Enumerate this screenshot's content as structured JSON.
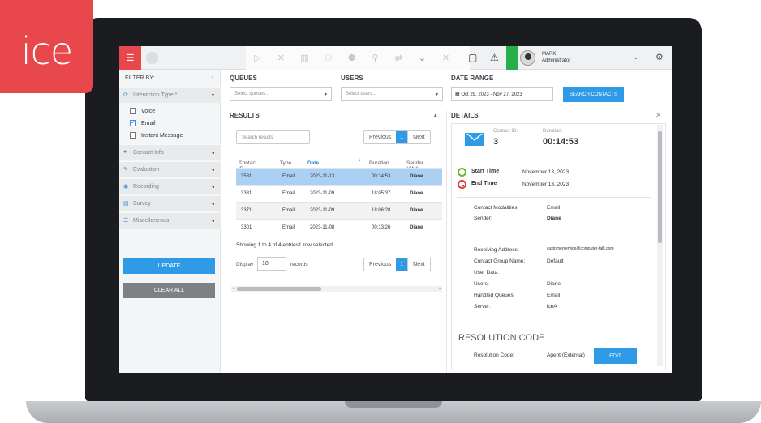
{
  "logo": {
    "text": "ice",
    "color": "#e8474b"
  },
  "topbar": {
    "menu_icon": "☰",
    "toolbar_icons": [
      "play-icon",
      "close-icon",
      "columns-icon",
      "users-icon",
      "team-icon",
      "tree-icon",
      "transfer-icon",
      "chevron-down-icon",
      "close-icon"
    ],
    "toolbar_glyphs": [
      "▷",
      "✕",
      "▥",
      "⚇",
      "⚉",
      "⚲",
      "⇄",
      "⌄",
      "✕"
    ],
    "chat_glyph": "▢",
    "warning_glyph": "⚠",
    "status_color": "#27b04a",
    "user": {
      "name": "MARK",
      "role": "Administrator"
    },
    "chevron": "⌄",
    "gear": "⚙"
  },
  "filter": {
    "heading": "FILTER BY:",
    "collapse": "‹",
    "interaction_type_label": "Interaction Type *",
    "options": [
      {
        "label": "Voice",
        "checked": false
      },
      {
        "label": "Email",
        "checked": true
      },
      {
        "label": "Instant Message",
        "checked": false
      }
    ],
    "sections": [
      "Contact Info",
      "Evaluation",
      "Recording",
      "Survey",
      "Miscellaneous"
    ],
    "section_glyphs": [
      "👤",
      "✎",
      "●",
      "⚑",
      "☰"
    ],
    "update_label": "UPDATE",
    "clear_label": "CLEAR ALL"
  },
  "queues": {
    "label": "QUEUES",
    "placeholder": "Select queues..."
  },
  "users": {
    "label": "USERS",
    "placeholder": "Select users..."
  },
  "date_range": {
    "label": "DATE RANGE",
    "value": "Oct 29, 2023 - Nov 27, 2023"
  },
  "search_button": "SEARCH CONTACTS",
  "results": {
    "label": "RESULTS",
    "search_placeholder": "Search results",
    "prev": "Previous",
    "page": "1",
    "next": "Next",
    "columns": [
      "Contact ID",
      "Type",
      "Date",
      "Duration",
      "Sender (ANI)"
    ],
    "rows": [
      {
        "id": "3581",
        "type": "Email",
        "date": "2023-11-13",
        "duration": "00:14:53",
        "sender": "Diane"
      },
      {
        "id": "3381",
        "type": "Email",
        "date": "2023-11-09",
        "duration": "18:05:37",
        "sender": "Diane"
      },
      {
        "id": "3371",
        "type": "Email",
        "date": "2023-11-09",
        "duration": "18:06:28",
        "sender": "Diane"
      },
      {
        "id": "3301",
        "type": "Email",
        "date": "2023-11-08",
        "duration": "00:13:26",
        "sender": "Diane"
      }
    ],
    "summary": "Showing 1 to 4 of 4 entries1 row selected",
    "display_label": "Display",
    "display_value": "10",
    "records_label": "records"
  },
  "details": {
    "label": "DETAILS",
    "close": "✕",
    "contact_id_label": "Contact ID:",
    "contact_id": "3",
    "duration_label": "Duration:",
    "duration": "00:14:53",
    "start_label": "Start Time",
    "start_value": "November 13, 2023",
    "end_label": "End Time",
    "end_value": "November 13, 2023",
    "fields": [
      {
        "key": "Contact Modalities:",
        "value": "Email"
      },
      {
        "key": "Sender:",
        "value": "Diane"
      },
      {
        "key": "Receiving Address:",
        "value": "customerservice@computer-talk.com"
      },
      {
        "key": "Contact Group Name:",
        "value": "Default"
      },
      {
        "key": "User Data:",
        "value": ""
      },
      {
        "key": "Users:",
        "value": "Diane"
      },
      {
        "key": "Handled Queues:",
        "value": "Email"
      },
      {
        "key": "Server:",
        "value": "iceA"
      }
    ],
    "resolution_title": "RESOLUTION CODE",
    "resolution_label": "Resolution Code:",
    "resolution_value": "Agent (External)",
    "edit_label": "EDIT"
  }
}
